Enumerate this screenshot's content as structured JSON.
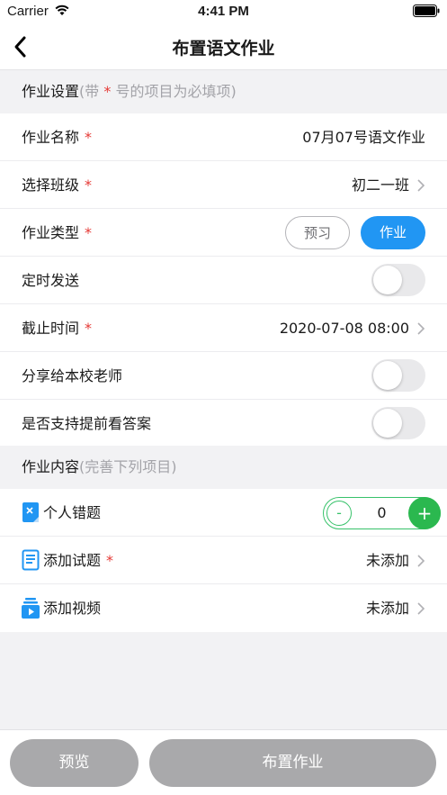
{
  "status_bar": {
    "carrier": "Carrier",
    "time": "4:41 PM"
  },
  "nav": {
    "title": "布置语文作业",
    "back_icon": "chevron-left-icon"
  },
  "settings_section": {
    "title": "作业设置",
    "hint_open": "(带 ",
    "star": "*",
    "hint_close": " 号的项目为必填项)"
  },
  "form": {
    "name": {
      "label": "作业名称",
      "required": "*",
      "value": "07月07号语文作业"
    },
    "class": {
      "label": "选择班级",
      "required": "*",
      "value": "初二一班"
    },
    "type": {
      "label": "作业类型",
      "required": "*",
      "options": [
        "预习",
        "作业"
      ],
      "selected": "作业"
    },
    "scheduled_send": {
      "label": "定时发送",
      "on": false
    },
    "deadline": {
      "label": "截止时间",
      "required": "*",
      "value": "2020-07-08 08:00"
    },
    "share_teachers": {
      "label": "分享给本校老师",
      "on": false
    },
    "show_answers_early": {
      "label": "是否支持提前看答案",
      "on": false
    }
  },
  "content_section": {
    "title": "作业内容",
    "hint": "(完善下列项目)"
  },
  "content": {
    "mistakes": {
      "label": "个人错题",
      "icon": "mistake-book-icon",
      "count": "0",
      "minus": "-",
      "plus": "+"
    },
    "questions": {
      "label": "添加试题",
      "required": "*",
      "icon": "question-list-icon",
      "value": "未添加"
    },
    "videos": {
      "label": "添加视频",
      "icon": "video-icon",
      "value": "未添加"
    }
  },
  "bottom": {
    "preview_label": "预览",
    "assign_label": "布置作业"
  },
  "colors": {
    "accent_blue": "#2196f3",
    "stepper_green": "#2bb84f",
    "required_red": "#e53935",
    "disabled_gray": "#a9a9ab"
  }
}
